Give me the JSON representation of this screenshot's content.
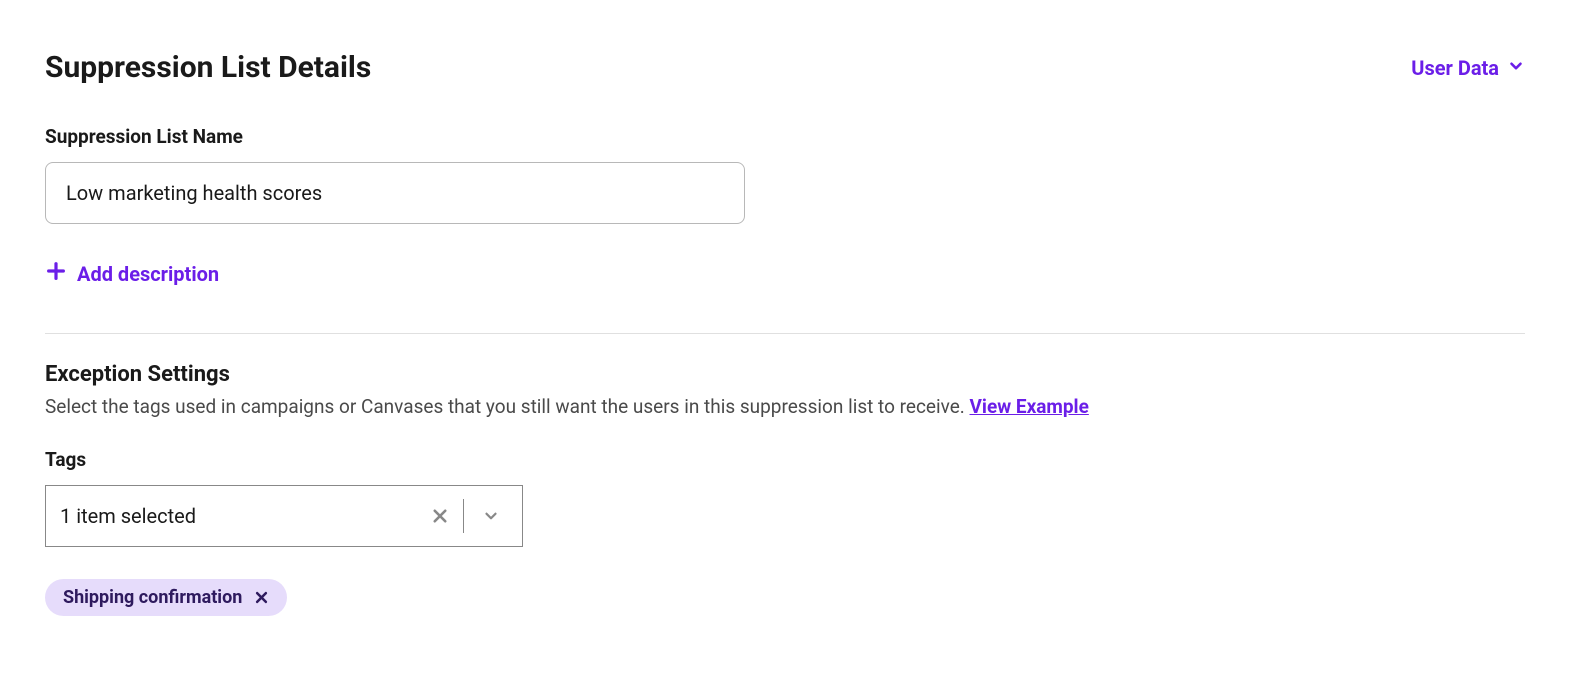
{
  "header": {
    "title": "Suppression List Details",
    "user_data_label": "User Data"
  },
  "name_field": {
    "label": "Suppression List Name",
    "value": "Low marketing health scores"
  },
  "add_description_label": "Add description",
  "exception": {
    "title": "Exception Settings",
    "description": "Select the tags used in campaigns or Canvases that you still want the users in this suppression list to receive. ",
    "view_example_label": "View Example"
  },
  "tags": {
    "label": "Tags",
    "selected_text": "1 item selected",
    "chips": [
      {
        "label": "Shipping confirmation"
      }
    ]
  }
}
